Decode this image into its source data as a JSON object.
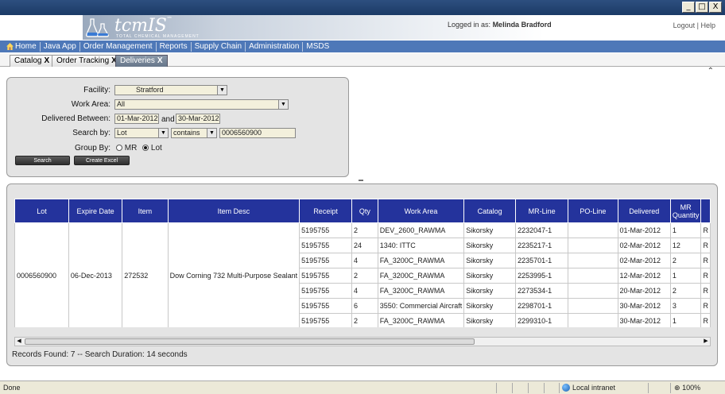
{
  "window": {
    "buttons": {
      "minimize": "_",
      "maximize": "□",
      "close": "X"
    }
  },
  "header": {
    "logo": {
      "name": "tcmIS",
      "tm": "™",
      "tagline": "TOTAL CHEMICAL MANAGEMENT"
    },
    "logged_in_label": "Logged in as:",
    "user_name": "Melinda Bradford",
    "logout": "Logout",
    "separator": "|",
    "help": "Help"
  },
  "nav": {
    "items": [
      "Home",
      "Java App",
      "Order Management",
      "Reports",
      "Supply Chain",
      "Administration",
      "MSDS"
    ]
  },
  "tabs": [
    {
      "label": "Catalog",
      "close": "X",
      "active": false
    },
    {
      "label": "Order Tracking",
      "close": "X",
      "active": false
    },
    {
      "label": "Deliveries",
      "close": "X",
      "active": true
    }
  ],
  "search": {
    "facility_label": "Facility:",
    "facility_value": "Stratford",
    "work_area_label": "Work Area:",
    "work_area_value": "All",
    "delivered_between_label": "Delivered Between:",
    "date_from": "01-Mar-2012",
    "and_label": "and",
    "date_to": "30-Mar-2012",
    "search_by_label": "Search by:",
    "search_by_value": "Lot",
    "operator_value": "contains",
    "search_text": "0006560900",
    "group_by_label": "Group By:",
    "group_mr": "MR",
    "group_lot": "Lot",
    "group_selected": "Lot",
    "search_button": "Search",
    "excel_button": "Create Excel"
  },
  "results": {
    "columns": [
      "Lot",
      "Expire Date",
      "Item",
      "Item Desc",
      "Receipt",
      "Qty",
      "Work Area",
      "Catalog",
      "MR-Line",
      "PO-Line",
      "Delivered",
      "MR Quantity",
      ""
    ],
    "group": {
      "lot": "0006560900",
      "expire_date": "06-Dec-2013",
      "item": "272532",
      "item_desc": "Dow Corning 732 Multi-Purpose Sealant"
    },
    "rows": [
      {
        "receipt": "5195755",
        "qty": "2",
        "work_area": "DEV_2600_RAWMA",
        "catalog": "Sikorsky",
        "mr_line": "2232047-1",
        "po_line": "",
        "delivered": "01-Mar-2012",
        "mr_qty": "1",
        "extra": "R"
      },
      {
        "receipt": "5195755",
        "qty": "24",
        "work_area": "1340: ITTC",
        "catalog": "Sikorsky",
        "mr_line": "2235217-1",
        "po_line": "",
        "delivered": "02-Mar-2012",
        "mr_qty": "12",
        "extra": "R"
      },
      {
        "receipt": "5195755",
        "qty": "4",
        "work_area": "FA_3200C_RAWMA",
        "catalog": "Sikorsky",
        "mr_line": "2235701-1",
        "po_line": "",
        "delivered": "02-Mar-2012",
        "mr_qty": "2",
        "extra": "R"
      },
      {
        "receipt": "5195755",
        "qty": "2",
        "work_area": "FA_3200C_RAWMA",
        "catalog": "Sikorsky",
        "mr_line": "2253995-1",
        "po_line": "",
        "delivered": "12-Mar-2012",
        "mr_qty": "1",
        "extra": "R"
      },
      {
        "receipt": "5195755",
        "qty": "4",
        "work_area": "FA_3200C_RAWMA",
        "catalog": "Sikorsky",
        "mr_line": "2273534-1",
        "po_line": "",
        "delivered": "20-Mar-2012",
        "mr_qty": "2",
        "extra": "R"
      },
      {
        "receipt": "5195755",
        "qty": "6",
        "work_area": "3550: Commercial Aircraft",
        "catalog": "Sikorsky",
        "mr_line": "2298701-1",
        "po_line": "",
        "delivered": "30-Mar-2012",
        "mr_qty": "3",
        "extra": "R"
      },
      {
        "receipt": "5195755",
        "qty": "2",
        "work_area": "FA_3200C_RAWMA",
        "catalog": "Sikorsky",
        "mr_line": "2299310-1",
        "po_line": "",
        "delivered": "30-Mar-2012",
        "mr_qty": "1",
        "extra": "R"
      }
    ],
    "records_text": "Records Found: 7 -- Search Duration: 14 seconds"
  },
  "statusbar": {
    "status": "Done",
    "zone": "Local intranet",
    "zoom": "100%"
  },
  "colors": {
    "nav_bg": "#4e78b8",
    "grid_header": "#24339c",
    "title_bar": "#1b3a66"
  }
}
